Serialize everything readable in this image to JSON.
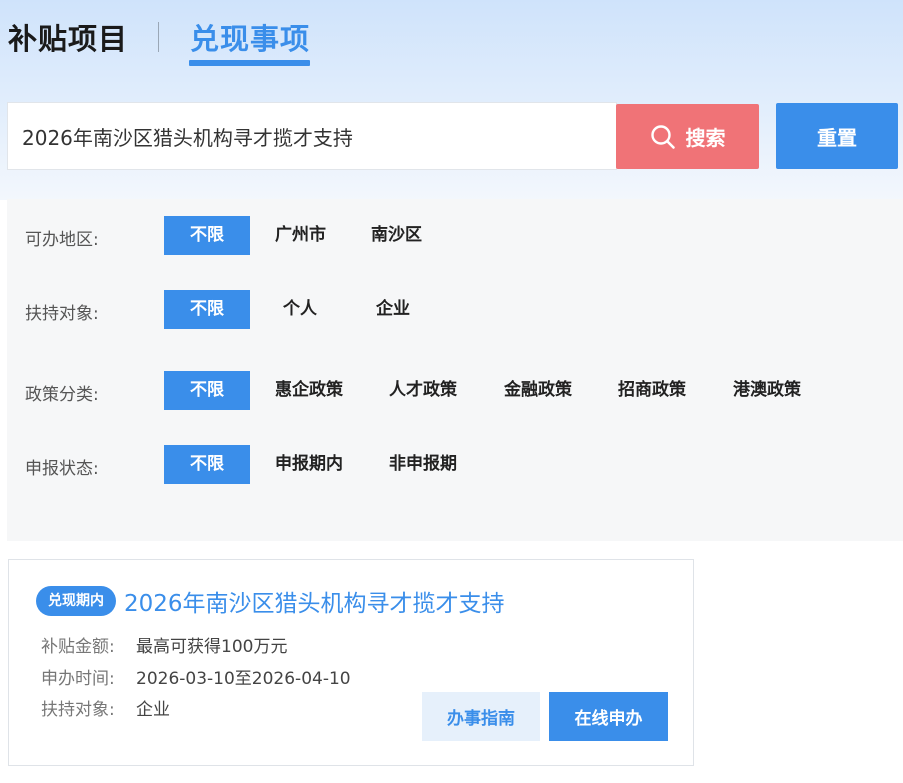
{
  "tabs": [
    {
      "label": "补贴项目"
    },
    {
      "label": "兑现事项"
    }
  ],
  "search": {
    "value": "2026年南沙区猎头机构寻才揽才支持",
    "button_label": "搜索",
    "reset_label": "重置"
  },
  "filters": {
    "region": {
      "label": "可办地区:",
      "options": [
        "不限",
        "广州市",
        "南沙区"
      ]
    },
    "target": {
      "label": "扶持对象:",
      "options": [
        "不限",
        "个人",
        "企业"
      ]
    },
    "category": {
      "label": "政策分类:",
      "options": [
        "不限",
        "惠企政策",
        "人才政策",
        "金融政策",
        "招商政策",
        "港澳政策"
      ]
    },
    "status": {
      "label": "申报状态:",
      "options": [
        "不限",
        "申报期内",
        "非申报期"
      ]
    }
  },
  "card": {
    "badge": "兑现期内",
    "title": "2026年南沙区猎头机构寻才揽才支持",
    "amount_label": "补贴金额:",
    "amount_value": "最高可获得100万元",
    "time_label": "申办时间:",
    "time_value": "2026-03-10至2026-04-10",
    "target_label": "扶持对象:",
    "target_value": "企业",
    "guide_label": "办事指南",
    "apply_label": "在线申办"
  },
  "colors": {
    "accent": "#3a8eea",
    "search_button": "#f07377"
  },
  "icons": {
    "search_button_icon": "search-icon"
  }
}
